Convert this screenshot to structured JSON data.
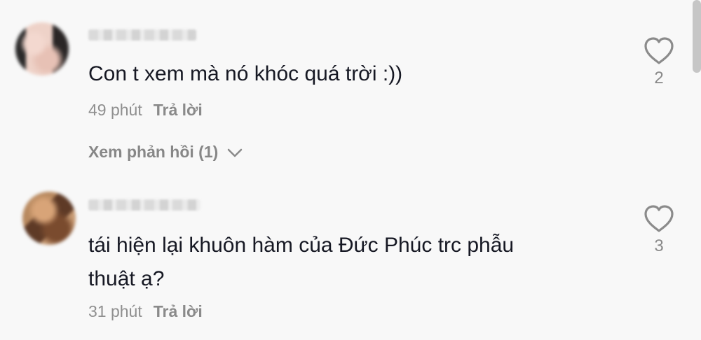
{
  "comments": [
    {
      "text": "Con t xem mà nó khóc quá trời :))",
      "time": "49 phút",
      "reply_label": "Trả lời",
      "replies_label": "Xem phản hồi (1)",
      "likes": "2"
    },
    {
      "text_line_1": "tái hiện lại khuôn hàm của Đức Phúc trc phẫu",
      "text_line_2": "thuật ạ?",
      "time": "31 phút",
      "reply_label": "Trả lời",
      "likes": "3"
    }
  ],
  "icons": {
    "heart": "heart-outline-icon",
    "chevron": "chevron-down-icon"
  }
}
